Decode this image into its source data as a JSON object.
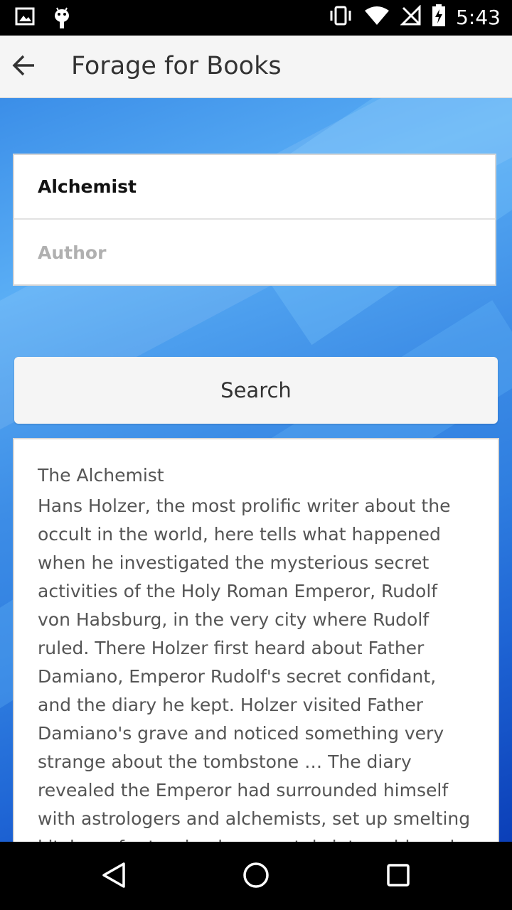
{
  "status_bar": {
    "time": "5:43",
    "left_icons": [
      "image-icon",
      "android-icon"
    ],
    "right_icons": [
      "vibrate-icon",
      "wifi-icon",
      "no-signal-icon",
      "battery-charging-icon"
    ]
  },
  "app_bar": {
    "title": "Forage for Books",
    "back_icon": "arrow-back-icon"
  },
  "form": {
    "title_value": "Alchemist",
    "author_placeholder": "Author",
    "author_value": ""
  },
  "search_button": {
    "label": "Search"
  },
  "result": {
    "title": "The Alchemist",
    "description": "Hans Holzer, the most prolific writer about the occult in the world, here tells what happened when he investigated the mysterious secret activities of the Holy Roman Emperor, Rudolf von Habsburg, in the very city where Rudolf ruled. There Holzer first heard about Father Damiano, Emperor Rudolf's secret confidant, and the diary he kept. Holzer visited Father Damiano's grave and noticed something very strange about the tombstone … The diary revealed the Emperor had surrounded himself with astrologers and alchemists, set up smelting kitchens for turning base metals into gold, and practiced secret rituals."
  },
  "nav_bar": {
    "icons": [
      "back-triangle-icon",
      "home-circle-icon",
      "recents-square-icon"
    ]
  },
  "colors": {
    "app_bar_bg": "#f5f5f5",
    "background_gradient_top": "#3b8ee8",
    "background_gradient_bottom": "#0b3fb8"
  }
}
